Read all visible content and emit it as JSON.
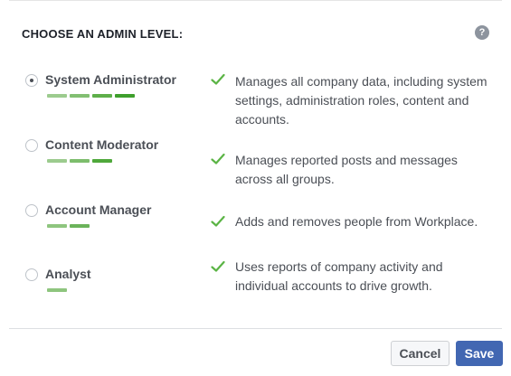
{
  "header": {
    "title": "CHOOSE AN ADMIN LEVEL:",
    "help_icon": "question-circle-icon"
  },
  "levels": [
    {
      "label": "System Administrator",
      "selected": true,
      "strength_bars": 4,
      "description": "Manages all company data, including system settings, administration roles, content and accounts."
    },
    {
      "label": "Content Moderator",
      "selected": false,
      "strength_bars": 3,
      "description": "Manages reported posts and messages across all groups."
    },
    {
      "label": "Account Manager",
      "selected": false,
      "strength_bars": 2,
      "description": "Adds and removes people from Workplace."
    },
    {
      "label": "Analyst",
      "selected": false,
      "strength_bars": 1,
      "description": "Uses reports of company activity and individual accounts to drive growth."
    }
  ],
  "footer": {
    "cancel_label": "Cancel",
    "save_label": "Save"
  },
  "colors": {
    "bar_light": "#9ccb8e",
    "bar_mid": "#6bb35a",
    "bar_dark": "#42a32f",
    "check": "#5bb445",
    "save_button": "#4267b2"
  }
}
